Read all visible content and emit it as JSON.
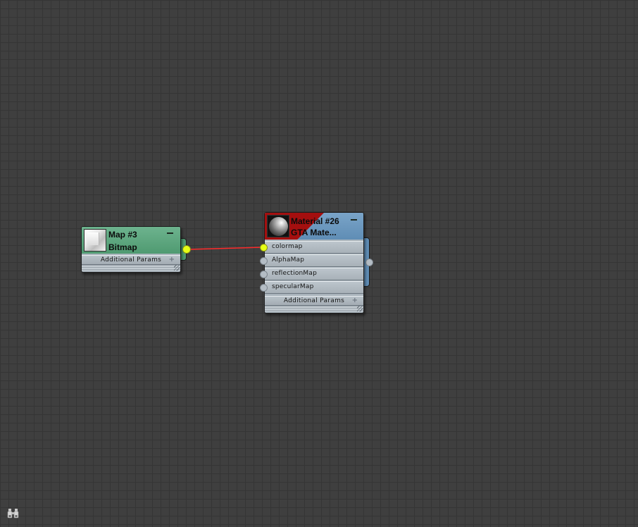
{
  "app": {
    "search_icon": "binoculars-icon"
  },
  "colors": {
    "canvas_bg": "#3f3f3f",
    "grid_line": "#353535",
    "map_node_header": "#5aa57c",
    "material_node_header": "#6b95bb",
    "material_type_badge": "#a40f0f",
    "node_body": "#aab4bc",
    "connected_socket": "#e6ff16",
    "wire": "#ff2a2a"
  },
  "map_node": {
    "title": "Map #3",
    "type": "Bitmap",
    "additional_params": "Additional Params",
    "thumbnail_icon": "bitmap-thumbnail-icon"
  },
  "material_node": {
    "title": "Material #26",
    "type": "GTA  Mate...",
    "thumbnail_icon": "material-sphere-icon",
    "params": [
      {
        "label": "colormap",
        "connected": true
      },
      {
        "label": "AlphaMap",
        "connected": false
      },
      {
        "label": "reflectionMap",
        "connected": false
      },
      {
        "label": "specularMap",
        "connected": false
      }
    ],
    "additional_params": "Additional Params"
  }
}
